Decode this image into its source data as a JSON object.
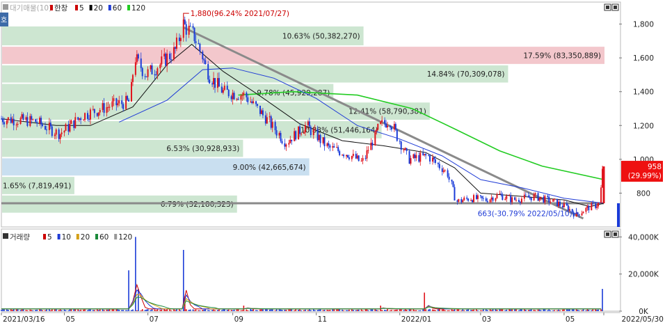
{
  "header": {
    "indicator_label": "대기매물(10)",
    "legend": [
      {
        "text": "한창",
        "color": "#cc0000"
      },
      {
        "text": "5",
        "color": "#cc0000"
      },
      {
        "text": "20",
        "color": "#000000"
      },
      {
        "text": "60",
        "color": "#1f3bd6"
      },
      {
        "text": "120",
        "color": "#22cc22"
      }
    ],
    "side_tab": "호"
  },
  "volume_header": {
    "title": "거래량",
    "legend": [
      {
        "text": "5",
        "color": "#cc0000"
      },
      {
        "text": "10",
        "color": "#1f3bd6"
      },
      {
        "text": "20",
        "color": "#d4a017"
      },
      {
        "text": "60",
        "color": "#1a8a3a"
      },
      {
        "text": "120",
        "color": "#999999"
      }
    ]
  },
  "chart_data": [
    {
      "type": "candlestick",
      "title": "",
      "x_tick_labels": [
        "2021/03/16",
        "05",
        "07",
        "09",
        "11",
        "2022/01",
        "03",
        "05",
        "2022/05/30"
      ],
      "y_ticks": [
        800,
        1000,
        1200,
        1400,
        1600,
        1800
      ],
      "y_tick_labels": [
        "800",
        "1,000",
        "1,200",
        "1,400",
        "1,600",
        "1,800"
      ],
      "ylim": [
        600,
        1930
      ],
      "price_path": [
        {
          "date": "2021-03-16",
          "close": 1240
        },
        {
          "date": "2021-04-10",
          "close": 1225
        },
        {
          "date": "2021-04-28",
          "close": 1150
        },
        {
          "date": "2021-05-15",
          "close": 1260
        },
        {
          "date": "2021-06-05",
          "close": 1320
        },
        {
          "date": "2021-06-18",
          "close": 1340
        },
        {
          "date": "2021-06-22",
          "close": 1600
        },
        {
          "date": "2021-06-30",
          "close": 1500
        },
        {
          "date": "2021-07-10",
          "close": 1560
        },
        {
          "date": "2021-07-22",
          "close": 1650
        },
        {
          "date": "2021-07-27",
          "close": 1800
        },
        {
          "date": "2021-08-05",
          "close": 1720
        },
        {
          "date": "2021-08-15",
          "close": 1500
        },
        {
          "date": "2021-08-25",
          "close": 1400
        },
        {
          "date": "2021-09-10",
          "close": 1380
        },
        {
          "date": "2021-09-25",
          "close": 1250
        },
        {
          "date": "2021-10-10",
          "close": 1100
        },
        {
          "date": "2021-10-25",
          "close": 1200
        },
        {
          "date": "2021-11-10",
          "close": 1070
        },
        {
          "date": "2021-11-25",
          "close": 1030
        },
        {
          "date": "2021-12-05",
          "close": 980
        },
        {
          "date": "2021-12-18",
          "close": 1200
        },
        {
          "date": "2021-12-25",
          "close": 1230
        },
        {
          "date": "2022-01-08",
          "close": 1000
        },
        {
          "date": "2022-01-22",
          "close": 1020
        },
        {
          "date": "2022-02-05",
          "close": 920
        },
        {
          "date": "2022-02-12",
          "close": 750
        },
        {
          "date": "2022-02-22",
          "close": 770
        },
        {
          "date": "2022-03-05",
          "close": 760
        },
        {
          "date": "2022-03-15",
          "close": 790
        },
        {
          "date": "2022-03-25",
          "close": 760
        },
        {
          "date": "2022-04-10",
          "close": 780
        },
        {
          "date": "2022-04-25",
          "close": 745
        },
        {
          "date": "2022-05-05",
          "close": 710
        },
        {
          "date": "2022-05-10",
          "close": 670
        },
        {
          "date": "2022-05-18",
          "close": 710
        },
        {
          "date": "2022-05-27",
          "close": 737
        },
        {
          "date": "2022-05-30",
          "close": 958
        }
      ],
      "ma20": [
        {
          "date": "2021-03-16",
          "value": 1240
        },
        {
          "date": "2021-04-25",
          "value": 1200
        },
        {
          "date": "2021-05-20",
          "value": 1200
        },
        {
          "date": "2021-06-20",
          "value": 1310
        },
        {
          "date": "2021-07-15",
          "value": 1560
        },
        {
          "date": "2021-08-02",
          "value": 1680
        },
        {
          "date": "2021-08-25",
          "value": 1520
        },
        {
          "date": "2021-09-20",
          "value": 1380
        },
        {
          "date": "2021-10-20",
          "value": 1210
        },
        {
          "date": "2021-11-20",
          "value": 1110
        },
        {
          "date": "2021-12-20",
          "value": 1080
        },
        {
          "date": "2022-01-20",
          "value": 1040
        },
        {
          "date": "2022-02-10",
          "value": 950
        },
        {
          "date": "2022-03-01",
          "value": 800
        },
        {
          "date": "2022-04-01",
          "value": 780
        },
        {
          "date": "2022-05-01",
          "value": 760
        },
        {
          "date": "2022-05-20",
          "value": 720
        },
        {
          "date": "2022-05-30",
          "value": 740
        }
      ],
      "ma60": [
        {
          "date": "2021-06-10",
          "value": 1220
        },
        {
          "date": "2021-07-15",
          "value": 1350
        },
        {
          "date": "2021-08-10",
          "value": 1530
        },
        {
          "date": "2021-09-01",
          "value": 1540
        },
        {
          "date": "2021-10-01",
          "value": 1480
        },
        {
          "date": "2021-11-01",
          "value": 1360
        },
        {
          "date": "2021-12-01",
          "value": 1200
        },
        {
          "date": "2022-01-01",
          "value": 1120
        },
        {
          "date": "2022-02-01",
          "value": 1020
        },
        {
          "date": "2022-03-01",
          "value": 880
        },
        {
          "date": "2022-04-01",
          "value": 830
        },
        {
          "date": "2022-05-01",
          "value": 770
        },
        {
          "date": "2022-05-30",
          "value": 740
        }
      ],
      "ma120": [
        {
          "date": "2021-09-05",
          "value": 1380
        },
        {
          "date": "2021-10-15",
          "value": 1400
        },
        {
          "date": "2021-12-01",
          "value": 1380
        },
        {
          "date": "2022-01-10",
          "value": 1300
        },
        {
          "date": "2022-02-10",
          "value": 1180
        },
        {
          "date": "2022-03-15",
          "value": 1050
        },
        {
          "date": "2022-04-15",
          "value": 960
        },
        {
          "date": "2022-05-30",
          "value": 880
        }
      ],
      "trendlines": [
        {
          "from": {
            "date": "2021-07-27",
            "value": 1780
          },
          "to": {
            "date": "2022-05-15",
            "value": 650
          }
        },
        {
          "from": {
            "date": "2021-03-16",
            "value": 740
          },
          "to": {
            "date": "2022-05-30",
            "value": 740
          }
        }
      ],
      "supply_zones": [
        {
          "label": "10.63% (50,382,270)",
          "ymin": 1670,
          "ymax": 1790,
          "extent": 0.6,
          "color": "#cde6d1"
        },
        {
          "label": "17.59% (83,350,889)",
          "ymin": 1560,
          "ymax": 1670,
          "extent": 1.0,
          "color": "#f3c7cc"
        },
        {
          "label": "14.84% (70,309,078)",
          "ymin": 1450,
          "ymax": 1560,
          "extent": 0.84,
          "color": "#cde6d1"
        },
        {
          "label": "9.78% (45,929,287)",
          "ymin": 1340,
          "ymax": 1450,
          "extent": 0.55,
          "color": "#cde6d1"
        },
        {
          "label": "12.41% (58,790,381)",
          "ymin": 1230,
          "ymax": 1340,
          "extent": 0.71,
          "color": "#cde6d1"
        },
        {
          "label": "10.88% (51,446,164)",
          "ymin": 1120,
          "ymax": 1230,
          "extent": 0.63,
          "color": "#cde6d1"
        },
        {
          "label": "6.53% (30,928,933)",
          "ymin": 1010,
          "ymax": 1120,
          "extent": 0.4,
          "color": "#cde6d1"
        },
        {
          "label": "9.00% (42,665,674)",
          "ymin": 900,
          "ymax": 1010,
          "extent": 0.51,
          "color": "#c9dff0"
        },
        {
          "label": "1.65% (7,819,491)",
          "ymin": 790,
          "ymax": 900,
          "extent": 0.12,
          "color": "#cde6d1"
        },
        {
          "label": "6.79% (32,180,323)",
          "ymin": 680,
          "ymax": 790,
          "extent": 0.39,
          "color": "#cde6d1"
        }
      ],
      "annotations": [
        {
          "text": "1,880(96.24% 2021/07/27)",
          "date": "2021-07-27",
          "value": 1880,
          "color": "#cc0000"
        },
        {
          "text": "663(-30.79% 2022/05/10)",
          "date": "2022-05-10",
          "value": 663,
          "color": "#1f3bd6"
        }
      ],
      "last_price": {
        "value": "958",
        "change": "(29.99%)"
      }
    },
    {
      "type": "bar",
      "title": "",
      "y_tick_labels": [
        "0K",
        "20,000K",
        "40,000K"
      ],
      "y_ticks": [
        0,
        20000,
        40000
      ],
      "ylim": [
        0,
        42000
      ],
      "volume_spikes": [
        {
          "date": "2021-06-22",
          "value": 40000
        },
        {
          "date": "2021-06-18",
          "value": 22000
        },
        {
          "date": "2021-06-25",
          "value": 12000
        },
        {
          "date": "2021-07-27",
          "value": 33000
        },
        {
          "date": "2021-07-29",
          "value": 8000
        },
        {
          "date": "2021-09-10",
          "value": 3000
        },
        {
          "date": "2021-12-18",
          "value": 3000
        },
        {
          "date": "2022-01-20",
          "value": 10000
        },
        {
          "date": "2022-05-30",
          "value": 12000
        }
      ]
    }
  ]
}
